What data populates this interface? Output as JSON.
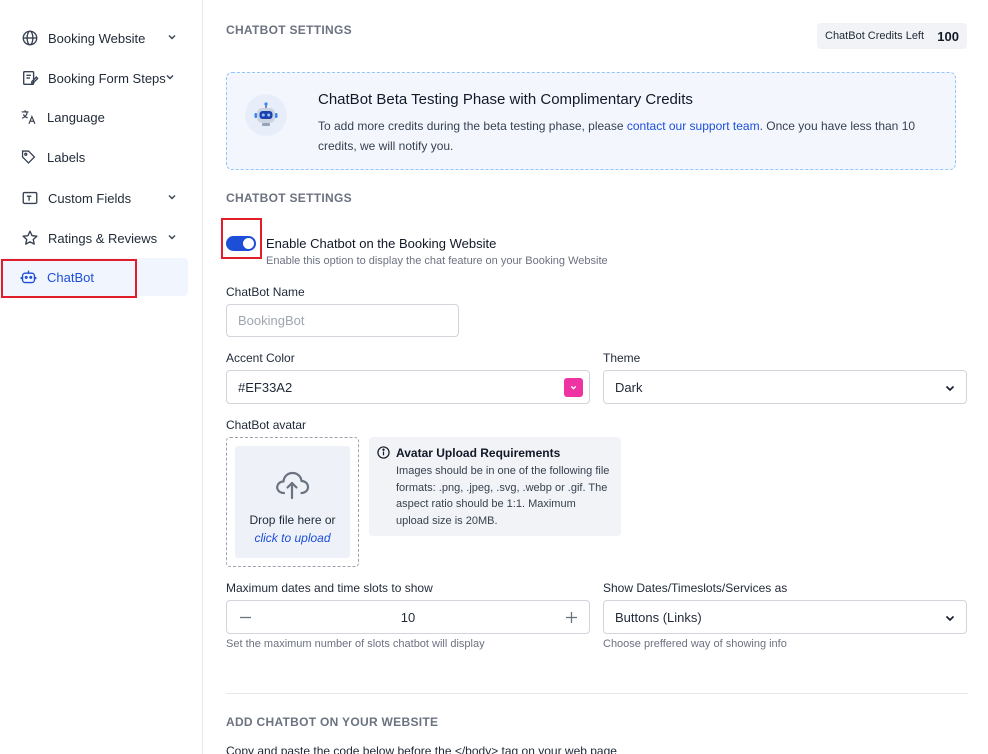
{
  "sidebar": {
    "items": [
      {
        "label": "Booking Website",
        "icon": "globe-icon",
        "has_chevron": true
      },
      {
        "label": "Booking Form Steps",
        "icon": "form-edit-icon",
        "has_chevron": true
      },
      {
        "label": "Language",
        "icon": "translate-icon",
        "has_chevron": false
      },
      {
        "label": "Labels",
        "icon": "tag-icon",
        "has_chevron": false
      },
      {
        "label": "Custom Fields",
        "icon": "text-field-icon",
        "has_chevron": true
      },
      {
        "label": "Ratings & Reviews",
        "icon": "star-icon",
        "has_chevron": true
      },
      {
        "label": "ChatBot",
        "icon": "robot-icon",
        "has_chevron": false,
        "active": true
      }
    ]
  },
  "header": {
    "title": "CHATBOT SETTINGS",
    "credits_label": "ChatBot Credits Left",
    "credits_value": "100"
  },
  "beta_notice": {
    "title": "ChatBot Beta Testing Phase with Complimentary Credits",
    "text_before": "To add more credits during the beta testing phase, please ",
    "link_text": "contact our support team",
    "text_after": ". Once you have less than 10 credits, we will notify you."
  },
  "settings": {
    "section_title": "CHATBOT SETTINGS",
    "enable_label": "Enable Chatbot on the Booking Website",
    "enable_help": "Enable this option to display the chat feature on your Booking Website",
    "enabled": true,
    "name_label": "ChatBot Name",
    "name_placeholder": "BookingBot",
    "accent_label": "Accent Color",
    "accent_value": "#EF33A2",
    "theme_label": "Theme",
    "theme_value": "Dark",
    "avatar_label": "ChatBot avatar",
    "drop_text": "Drop file here or",
    "upload_link": "click to upload",
    "req_title": "Avatar Upload Requirements",
    "req_text": "Images should be in one of the following file formats: .png, .jpeg, .svg, .webp or .gif. The aspect ratio should be 1:1. Maximum upload size is 20MB.",
    "max_slots_label": "Maximum dates and time slots to show",
    "max_slots_value": "10",
    "max_slots_help": "Set the maximum number of slots chatbot will display",
    "show_as_label": "Show Dates/Timeslots/Services as",
    "show_as_value": "Buttons (Links)",
    "show_as_help": "Choose preffered way of showing info"
  },
  "embed": {
    "section_title": "ADD CHATBOT ON YOUR WEBSITE",
    "copy_text": "Copy and paste the code below before the </body> tag on your web page"
  },
  "colors": {
    "accent": "#EF33A2",
    "primary": "#1D4ED8",
    "highlight": "#E11D2A"
  }
}
